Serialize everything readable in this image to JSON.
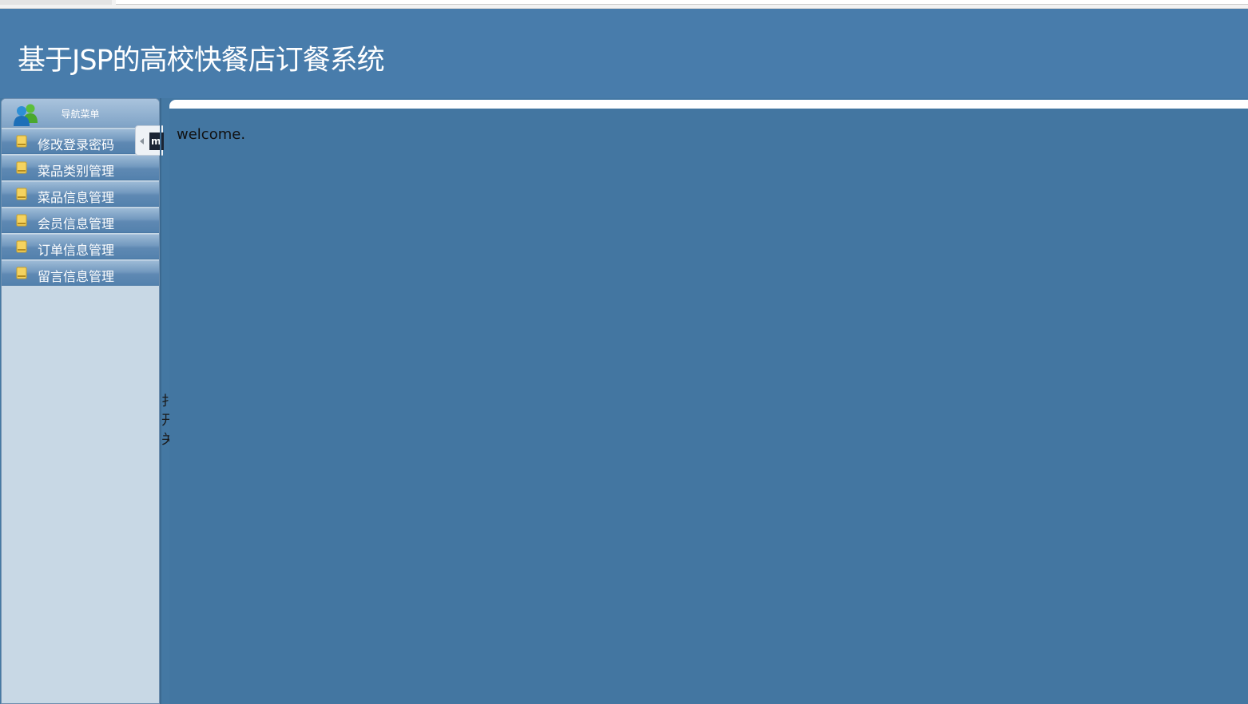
{
  "header": {
    "title": "基于JSP的高校快餐店订餐系统"
  },
  "sidebar": {
    "heading": "导航菜单",
    "heading_icon": "users-icon",
    "items": [
      {
        "label": "修改登录密码",
        "icon": "folder-icon"
      },
      {
        "label": "菜品类别管理",
        "icon": "folder-icon"
      },
      {
        "label": "菜品信息管理",
        "icon": "folder-icon"
      },
      {
        "label": "会员信息管理",
        "icon": "folder-icon"
      },
      {
        "label": "订单信息管理",
        "icon": "folder-icon"
      },
      {
        "label": "留言信息管理",
        "icon": "folder-icon"
      }
    ]
  },
  "collapse": {
    "icon": "chevron-left-icon",
    "badge_text": "m"
  },
  "split_text": [
    "扌",
    "开",
    "关"
  ],
  "content": {
    "welcome_text": "welcome."
  },
  "colors": {
    "header_bg": "#487cab",
    "page_bg": "#4478a3",
    "sidebar_bg": "#c8d8e5",
    "menu_item_bg": "#5f89b3"
  }
}
